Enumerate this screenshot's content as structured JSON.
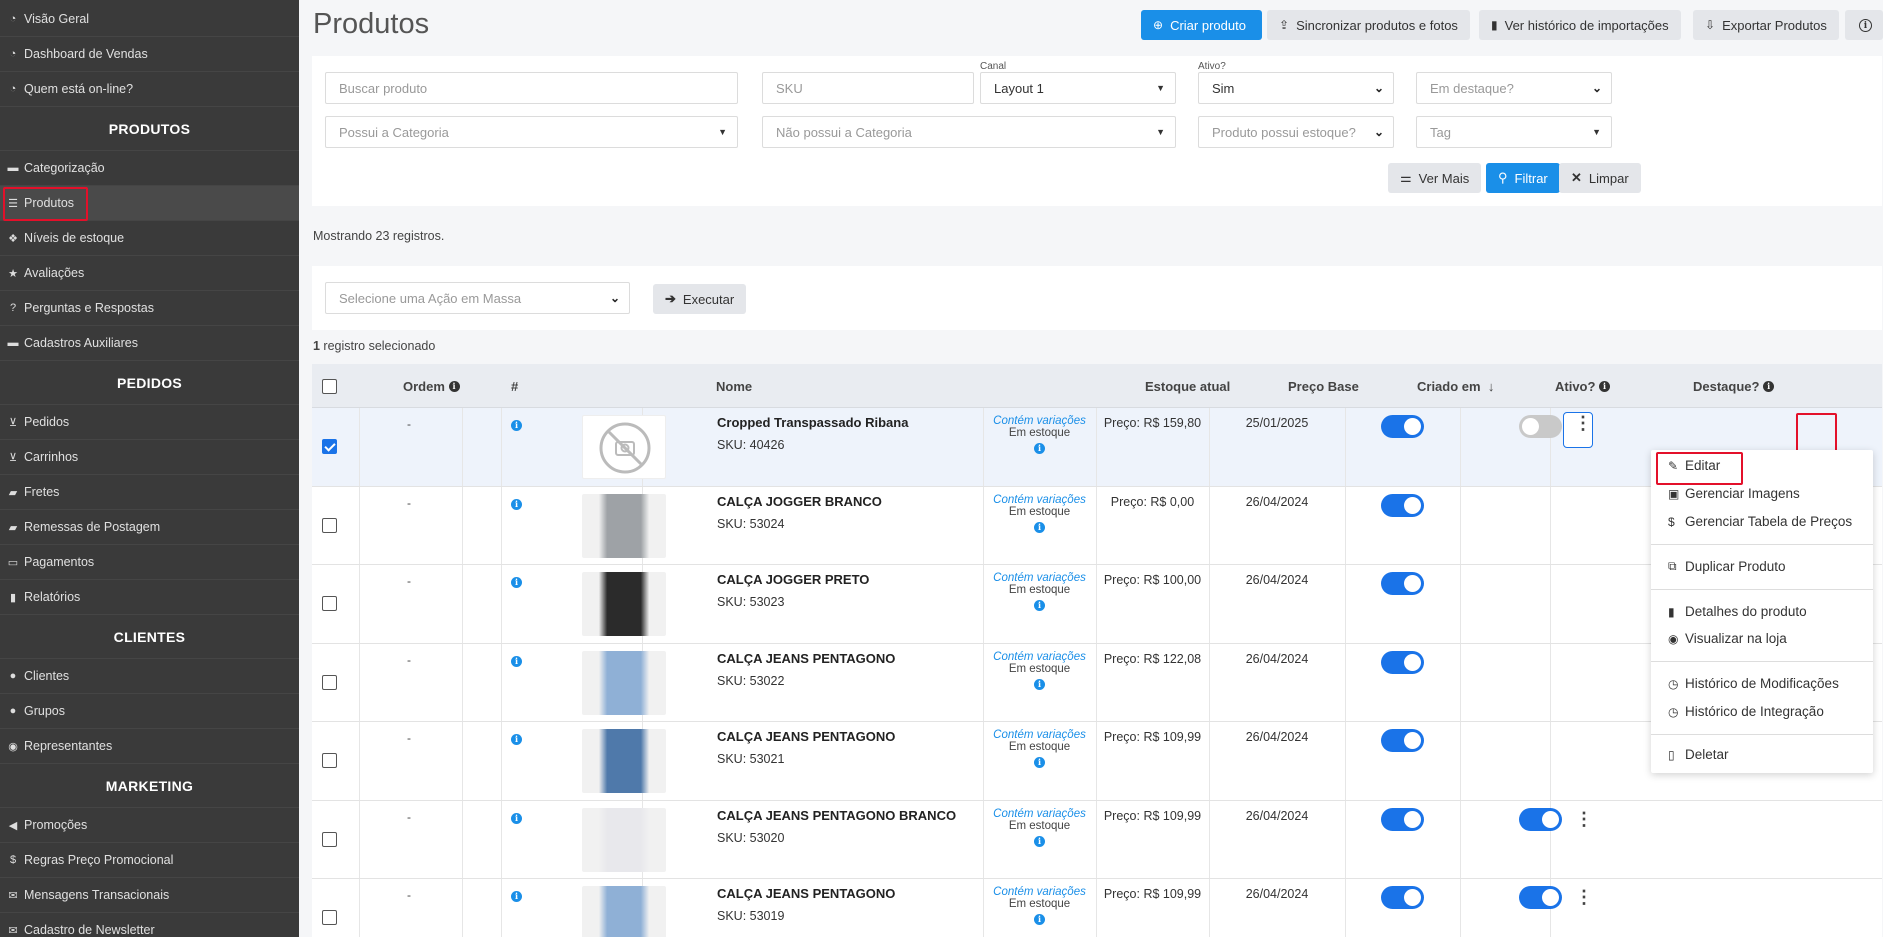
{
  "sidebar": {
    "items_top": [
      {
        "icon": "palette-icon",
        "label": "Visão Geral"
      },
      {
        "icon": "palette-icon",
        "label": "Dashboard de Vendas"
      },
      {
        "icon": "palette-icon",
        "label": "Quem está on-line?"
      }
    ],
    "sections": [
      {
        "title": "PRODUTOS",
        "items": [
          {
            "icon": "folder-icon",
            "label": "Categorização"
          },
          {
            "icon": "list-icon",
            "label": "Produtos"
          },
          {
            "icon": "cubes-icon",
            "label": "Níveis de estoque"
          },
          {
            "icon": "star-icon",
            "label": "Avaliações"
          },
          {
            "icon": "question-icon",
            "label": "Perguntas e Respostas"
          },
          {
            "icon": "folder-icon",
            "label": "Cadastros Auxiliares"
          }
        ]
      },
      {
        "title": "PEDIDOS",
        "items": [
          {
            "icon": "cart-icon",
            "label": "Pedidos"
          },
          {
            "icon": "cart-icon",
            "label": "Carrinhos"
          },
          {
            "icon": "truck-icon",
            "label": "Fretes"
          },
          {
            "icon": "truck-icon",
            "label": "Remessas de Postagem"
          },
          {
            "icon": "credit-card-icon",
            "label": "Pagamentos"
          },
          {
            "icon": "bar-chart-icon",
            "label": "Relatórios"
          }
        ]
      },
      {
        "title": "CLIENTES",
        "items": [
          {
            "icon": "user-icon",
            "label": "Clientes"
          },
          {
            "icon": "users-icon",
            "label": "Grupos"
          },
          {
            "icon": "user-circle-icon",
            "label": "Representantes"
          }
        ]
      },
      {
        "title": "MARKETING",
        "items": [
          {
            "icon": "bullhorn-icon",
            "label": "Promoções"
          },
          {
            "icon": "dollar-icon",
            "label": "Regras Preço Promocional"
          },
          {
            "icon": "envelope-icon",
            "label": "Mensagens Transacionais"
          },
          {
            "icon": "envelope-icon",
            "label": "Cadastro de Newsletter"
          }
        ]
      }
    ]
  },
  "page": {
    "title": "Produtos"
  },
  "toolbar": {
    "create": "Criar produto",
    "sync": "Sincronizar produtos e fotos",
    "history": "Ver histórico de importações",
    "export": "Exportar Produtos",
    "info": "i"
  },
  "filters": {
    "search_placeholder": "Buscar produto",
    "sku_placeholder": "SKU",
    "canal_label": "Canal",
    "canal_value": "Layout 1",
    "ativo_label": "Ativo?",
    "ativo_value": "Sim",
    "destaque_placeholder": "Em destaque?",
    "has_category_placeholder": "Possui a Categoria",
    "no_category_placeholder": "Não possui a Categoria",
    "stock_placeholder": "Produto possui estoque?",
    "tag_placeholder": "Tag",
    "more": "Ver Mais",
    "filter": "Filtrar",
    "clear": "Limpar"
  },
  "records_text": "Mostrando 23 registros.",
  "bulk": {
    "placeholder": "Selecione uma Ação em Massa",
    "execute": "Executar"
  },
  "selection": {
    "count": "1",
    "text": " registro selecionado"
  },
  "table": {
    "headers": {
      "ordem": "Ordem",
      "hash": "#",
      "nome": "Nome",
      "estoque": "Estoque atual",
      "preco": "Preço Base",
      "criado": "Criado em",
      "ativo": "Ativo?",
      "destaque": "Destaque?"
    },
    "rows": [
      {
        "ordem": "-",
        "nome": "Cropped Transpassado Ribana",
        "sku": "SKU: 40426",
        "variations": "Contém variações",
        "stock": "Em estoque",
        "price": "Preço: R$ 159,80",
        "created": "25/01/2025",
        "active": true,
        "featured": false,
        "selected": true,
        "image": "no-image"
      },
      {
        "ordem": "-",
        "nome": "CALÇA JOGGER BRANCO",
        "sku": "SKU: 53024",
        "variations": "Contém variações",
        "stock": "Em estoque",
        "price": "Preço: R$ 0,00",
        "created": "26/04/2024",
        "active": true,
        "featured": null,
        "selected": false,
        "image": "gray"
      },
      {
        "ordem": "-",
        "nome": "CALÇA JOGGER PRETO",
        "sku": "SKU: 53023",
        "variations": "Contém variações",
        "stock": "Em estoque",
        "price": "Preço: R$ 100,00",
        "created": "26/04/2024",
        "active": true,
        "featured": null,
        "selected": false,
        "image": "black"
      },
      {
        "ordem": "-",
        "nome": "CALÇA JEANS PENTAGONO",
        "sku": "SKU: 53022",
        "variations": "Contém variações",
        "stock": "Em estoque",
        "price": "Preço: R$ 122,08",
        "created": "26/04/2024",
        "active": true,
        "featured": null,
        "selected": false,
        "image": "lightblue"
      },
      {
        "ordem": "-",
        "nome": "CALÇA JEANS PENTAGONO",
        "sku": "SKU: 53021",
        "variations": "Contém variações",
        "stock": "Em estoque",
        "price": "Preço: R$ 109,99",
        "created": "26/04/2024",
        "active": true,
        "featured": null,
        "selected": false,
        "image": "blue"
      },
      {
        "ordem": "-",
        "nome": "CALÇA JEANS PENTAGONO BRANCO",
        "sku": "SKU: 53020",
        "variations": "Contém variações",
        "stock": "Em estoque",
        "price": "Preço: R$ 109,99",
        "created": "26/04/2024",
        "active": true,
        "featured": true,
        "selected": false,
        "image": "white"
      },
      {
        "ordem": "-",
        "nome": "CALÇA JEANS PENTAGONO",
        "sku": "SKU: 53019",
        "variations": "Contém variações",
        "stock": "Em estoque",
        "price": "Preço: R$ 109,99",
        "created": "26/04/2024",
        "active": true,
        "featured": true,
        "selected": false,
        "image": "lightblue"
      }
    ]
  },
  "menu": {
    "edit": "Editar",
    "images": "Gerenciar Imagens",
    "prices": "Gerenciar Tabela de Preços",
    "duplicate": "Duplicar Produto",
    "details": "Detalhes do produto",
    "view": "Visualizar na loja",
    "history_mod": "Histórico de Modificações",
    "history_int": "Histórico de Integração",
    "delete": "Deletar"
  },
  "colors": {
    "primary": "#1a8fe8",
    "highlight": "#e3102a",
    "sidebar": "#3a3a3a"
  }
}
